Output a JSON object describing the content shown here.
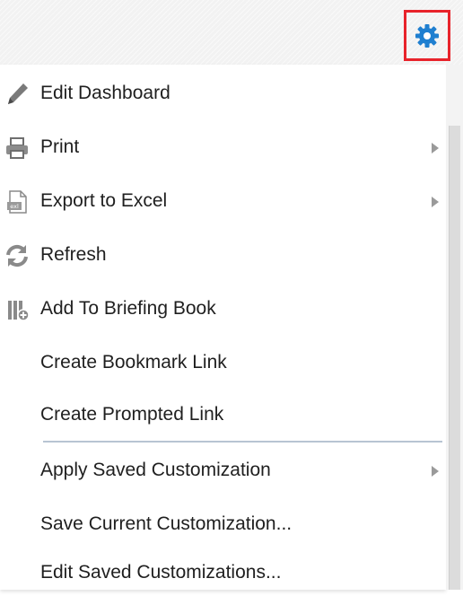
{
  "toolbar": {
    "settings_icon": "gear-icon",
    "highlight_color": "#e8232b",
    "gear_color": "#1f7fd0"
  },
  "menu": {
    "items": [
      {
        "label": "Edit Dashboard",
        "icon": "pencil-icon",
        "submenu": false
      },
      {
        "label": "Print",
        "icon": "printer-icon",
        "submenu": true
      },
      {
        "label": "Export to Excel",
        "icon": "excel-icon",
        "submenu": true
      },
      {
        "label": "Refresh",
        "icon": "refresh-icon",
        "submenu": false
      },
      {
        "label": "Add To Briefing Book",
        "icon": "briefing-book-icon",
        "submenu": false
      },
      {
        "label": "Create Bookmark Link",
        "icon": "",
        "submenu": false
      },
      {
        "label": "Create Prompted Link",
        "icon": "",
        "submenu": false
      },
      {
        "label": "Apply Saved Customization",
        "icon": "",
        "submenu": true
      },
      {
        "label": "Save Current Customization...",
        "icon": "",
        "submenu": false
      },
      {
        "label": "Edit Saved Customizations...",
        "icon": "",
        "submenu": false
      }
    ]
  }
}
